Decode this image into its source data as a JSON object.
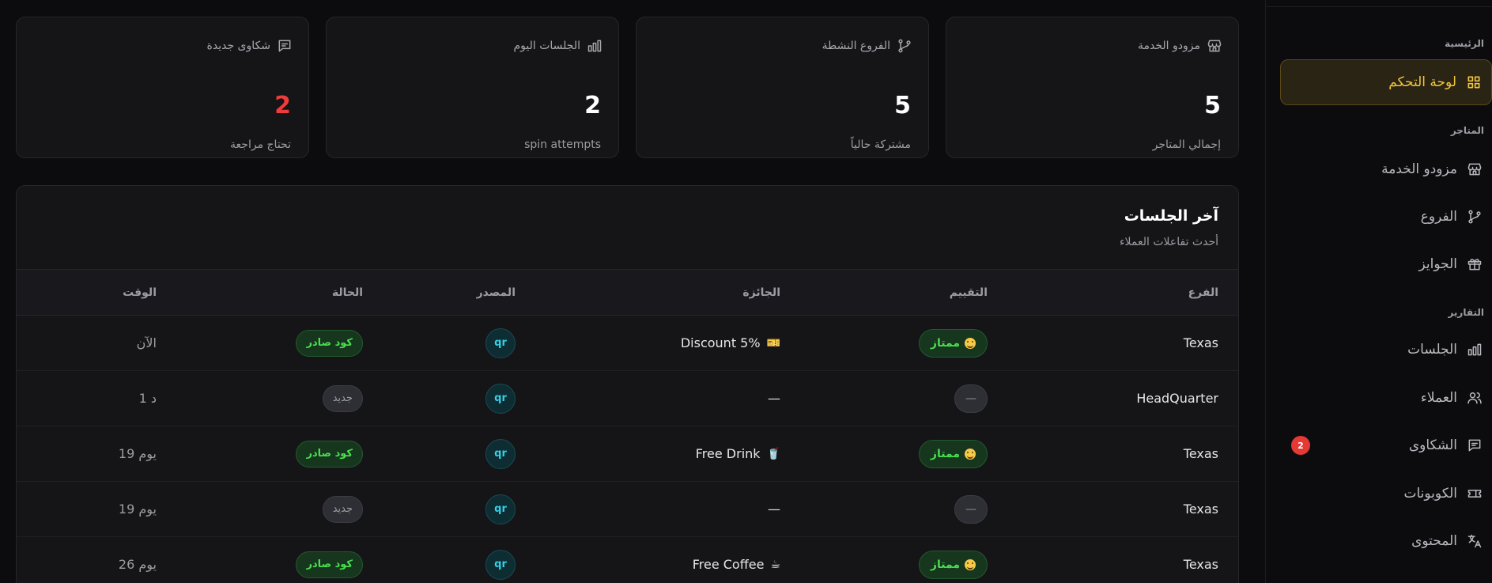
{
  "stats": [
    {
      "title": "مزودو الخدمة",
      "value": "5",
      "subtitle": "إجمالي المتاجر",
      "icon": "store-icon"
    },
    {
      "title": "الفروع النشطة",
      "value": "5",
      "subtitle": "مشتركة حالياً",
      "icon": "branch-icon"
    },
    {
      "title": "الجلسات اليوم",
      "value": "2",
      "subtitle": "spin attempts",
      "icon": "chart-icon"
    },
    {
      "title": "شكاوى جديدة",
      "value": "2",
      "subtitle": "تحتاج مراجعة",
      "icon": "complaint-icon",
      "value_color": "#ef3b3b"
    }
  ],
  "sessions": {
    "title": "آخر الجلسات",
    "subtitle": "أحدث تفاعلات العملاء",
    "columns": {
      "branch": "الفرع",
      "rating": "التقييم",
      "prize": "الجائزة",
      "source": "المصدر",
      "status": "الحالة",
      "time": "الوقت"
    },
    "rows": [
      {
        "branch": "Texas",
        "rating": "ممتاز",
        "prize": "Discount 5%",
        "prize_icon": "🎫",
        "source": "qr",
        "status": "كود صادر",
        "time": "الآن"
      },
      {
        "branch": "HeadQuarter",
        "rating": "—",
        "prize": "—",
        "prize_icon": "",
        "source": "qr",
        "status": "جديد",
        "time": "1 د"
      },
      {
        "branch": "Texas",
        "rating": "ممتاز",
        "prize": "Free Drink",
        "prize_icon": "🥤",
        "source": "qr",
        "status": "كود صادر",
        "time": "19 يوم"
      },
      {
        "branch": "Texas",
        "rating": "—",
        "prize": "—",
        "prize_icon": "",
        "source": "qr",
        "status": "جديد",
        "time": "19 يوم"
      },
      {
        "branch": "Texas",
        "rating": "ممتاز",
        "prize": "Free Coffee",
        "prize_icon": "☕",
        "source": "qr",
        "status": "كود صادر",
        "time": "26 يوم"
      }
    ]
  },
  "sidebar": {
    "sections": {
      "home": "الرئيسية",
      "stores": "المتاجر",
      "reports": "التقارير"
    },
    "items": {
      "dashboard": "لوحة التحكم",
      "providers": "مزودو الخدمة",
      "branches": "الفروع",
      "prizes": "الجوايز",
      "sessions": "الجلسات",
      "customers": "العملاء",
      "complaints": "الشكاوى",
      "complaints_badge": "2",
      "coupons": "الكوبونات",
      "content": "المحتوى"
    }
  },
  "colors": {
    "accent": "#f2c53d",
    "success": "#4ade50",
    "danger": "#ef3b3b",
    "info": "#35d0e6"
  }
}
